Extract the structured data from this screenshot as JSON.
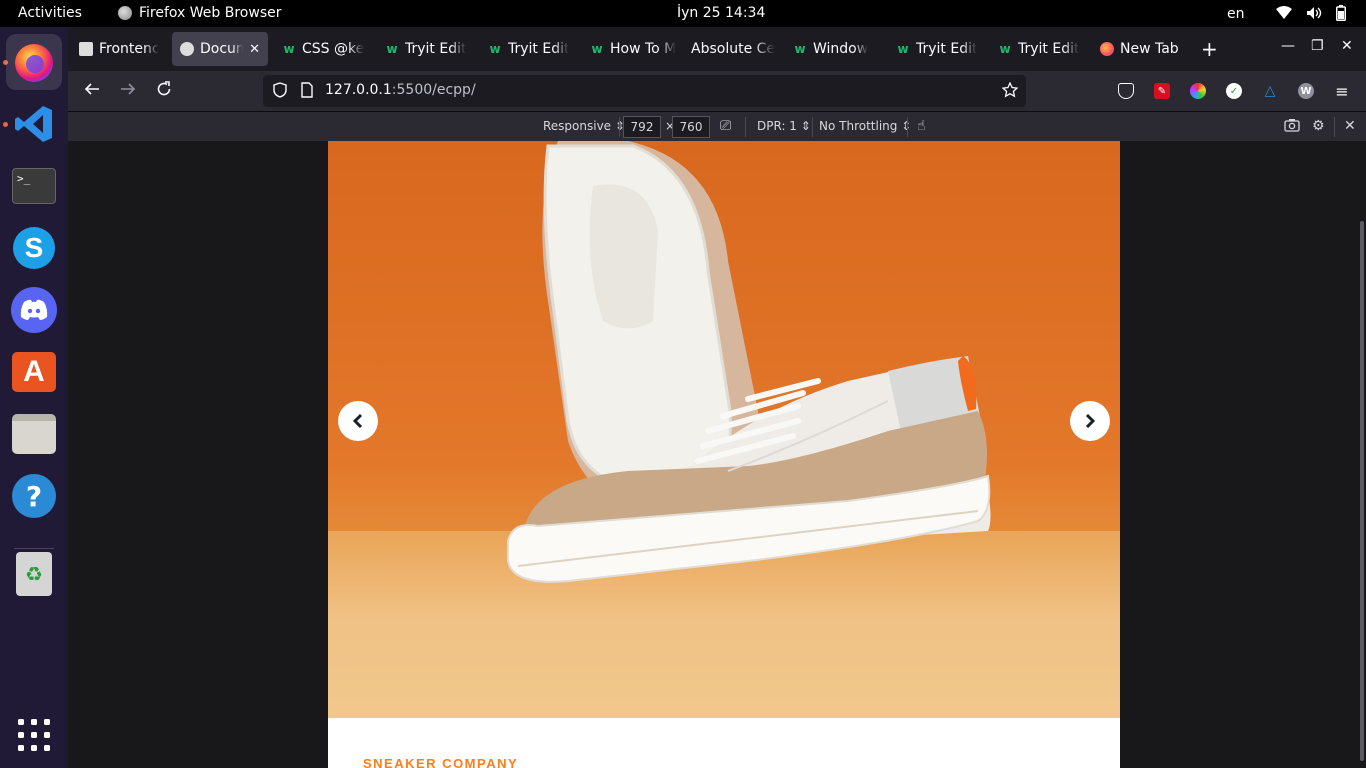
{
  "topbar": {
    "activities": "Activities",
    "app_name": "Firefox Web Browser",
    "clock": "İyn 25  14:34",
    "lang": "en",
    "tray_icons": [
      "wifi-icon",
      "volume-icon",
      "battery-icon"
    ]
  },
  "dock": {
    "items": [
      {
        "name": "firefox",
        "icon": "firefox-icon",
        "running": true
      },
      {
        "name": "vscode",
        "icon": "vscode-icon",
        "running": true
      },
      {
        "name": "terminal",
        "icon": "terminal-icon",
        "running": false
      },
      {
        "name": "skype",
        "icon": "skype-icon",
        "running": false
      },
      {
        "name": "discord",
        "icon": "discord-icon",
        "running": false
      },
      {
        "name": "software",
        "icon": "app-store-icon",
        "running": false
      },
      {
        "name": "files",
        "icon": "files-icon",
        "running": false
      },
      {
        "name": "help",
        "icon": "help-icon",
        "running": false
      },
      {
        "name": "trash",
        "icon": "trash-icon",
        "running": false
      }
    ],
    "show_apps_icon": "grid-icon"
  },
  "tabs": [
    {
      "label": "Frontenc",
      "favicon": "doc",
      "active": false
    },
    {
      "label": "Docum",
      "favicon": "globe",
      "active": true
    },
    {
      "label": "CSS @ke",
      "favicon": "wix",
      "active": false
    },
    {
      "label": "Tryit Edit",
      "favicon": "wix",
      "active": false
    },
    {
      "label": "Tryit Edit",
      "favicon": "wix",
      "active": false
    },
    {
      "label": "How To M",
      "favicon": "wix",
      "active": false
    },
    {
      "label": "Absolute Ce",
      "favicon": "none",
      "active": false
    },
    {
      "label": "Window",
      "favicon": "wix",
      "active": false
    },
    {
      "label": "Tryit Edit",
      "favicon": "wix",
      "active": false
    },
    {
      "label": "Tryit Edit",
      "favicon": "wix",
      "active": false
    },
    {
      "label": "New Tab",
      "favicon": "firefox",
      "active": false
    }
  ],
  "nav": {
    "url_host": "127.0.0.1",
    "url_rest": ":5500/ecpp/"
  },
  "rdm": {
    "device": "Responsive ⇕",
    "width": "792",
    "times": "×",
    "height": "760",
    "dpr": "DPR: 1 ⇕",
    "throttling": "No Throttling ⇕"
  },
  "page": {
    "company": "SNEAKER COMPANY",
    "prev_icon": "chevron-left-icon",
    "next_icon": "chevron-right-icon",
    "accent": "#ff7d1a"
  }
}
